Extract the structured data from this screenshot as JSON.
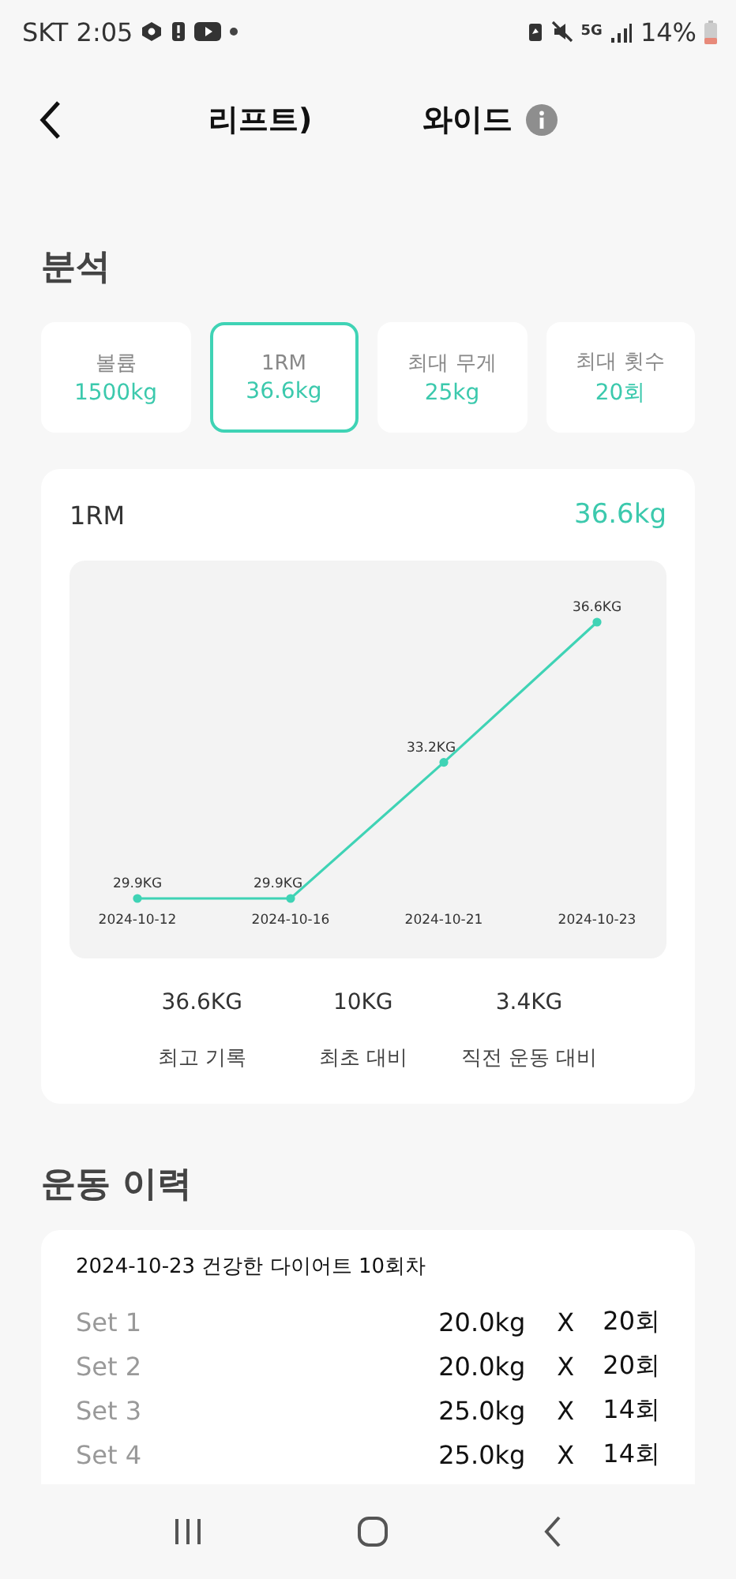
{
  "status_bar": {
    "carrier_time": "SKT 2:05",
    "network": "5G",
    "battery": "14%"
  },
  "header": {
    "title_parts": [
      "리프트)",
      "와이드"
    ]
  },
  "analysis": {
    "title": "분석",
    "metrics": [
      {
        "label": "볼륨",
        "value": "1500kg",
        "selected": false
      },
      {
        "label": "1RM",
        "value": "36.6kg",
        "selected": true
      },
      {
        "label": "최대 무게",
        "value": "25kg",
        "selected": false
      },
      {
        "label": "최대 횟수",
        "value": "20회",
        "selected": false
      }
    ],
    "chart_card": {
      "title": "1RM",
      "value": "36.6kg",
      "chart_data": {
        "type": "line",
        "categories": [
          "2024-10-12",
          "2024-10-16",
          "2024-10-21",
          "2024-10-23"
        ],
        "series": [
          {
            "color": "#3fd3b5",
            "marker": "circle",
            "values": [
              29.9,
              29.9,
              33.2,
              36.6
            ],
            "value_labels": [
              "29.9KG",
              "29.9KG",
              "33.2KG",
              "36.6KG"
            ]
          }
        ],
        "data_labels": true
      },
      "stats": [
        {
          "value": "36.6KG",
          "label": "최고 기록"
        },
        {
          "value": "10KG",
          "label": "최초 대비"
        },
        {
          "value": "3.4KG",
          "label": "직전 운동 대비"
        }
      ]
    }
  },
  "history": {
    "title": "운동 이력",
    "entry": {
      "heading": "2024-10-23  건강한 다이어트 10회차",
      "sets": [
        {
          "name": "Set 1",
          "weight": "20.0kg",
          "x": "X",
          "reps": "20회"
        },
        {
          "name": "Set 2",
          "weight": "20.0kg",
          "x": "X",
          "reps": "20회"
        },
        {
          "name": "Set 3",
          "weight": "25.0kg",
          "x": "X",
          "reps": "14회"
        },
        {
          "name": "Set 4",
          "weight": "25.0kg",
          "x": "X",
          "reps": "14회"
        }
      ]
    }
  }
}
